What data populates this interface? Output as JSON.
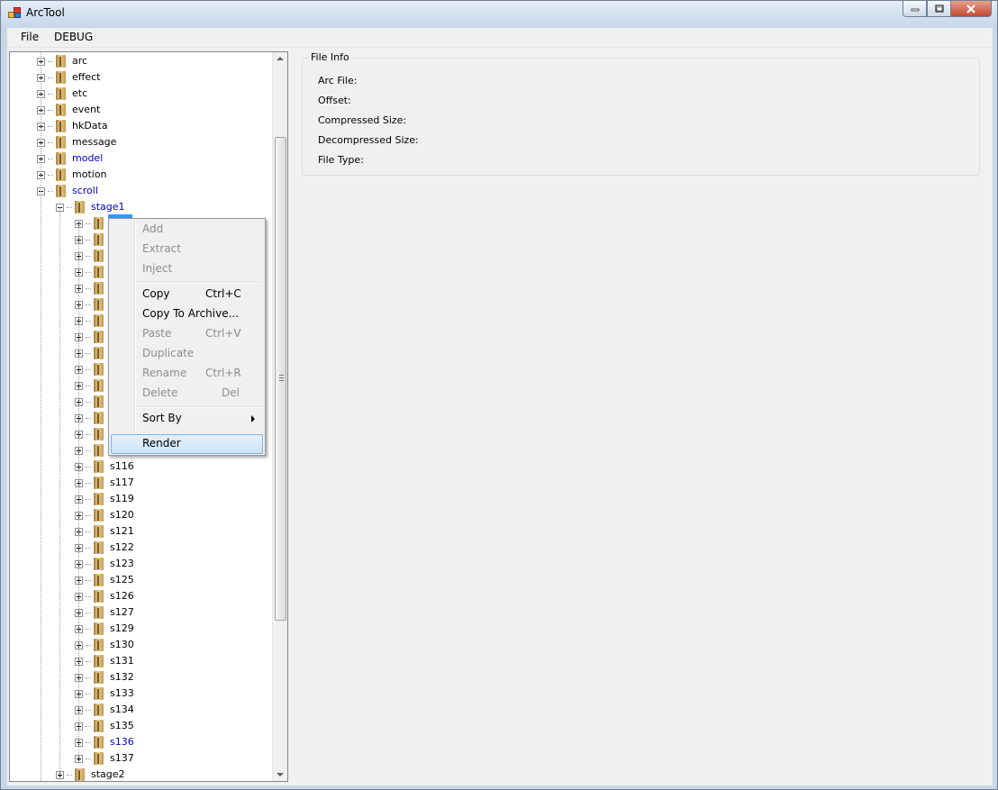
{
  "window": {
    "title": "ArcTool"
  },
  "menubar": {
    "items": [
      "File",
      "DEBUG"
    ]
  },
  "tree": {
    "top": [
      {
        "label": "arc",
        "blue": false
      },
      {
        "label": "effect",
        "blue": false
      },
      {
        "label": "etc",
        "blue": false
      },
      {
        "label": "event",
        "blue": false
      },
      {
        "label": "hkData",
        "blue": false
      },
      {
        "label": "message",
        "blue": false
      },
      {
        "label": "model",
        "blue": true
      },
      {
        "label": "motion",
        "blue": false
      },
      {
        "label": "scroll",
        "blue": true
      }
    ],
    "stage1": "stage1",
    "hidden_children_count": 15,
    "children": [
      {
        "label": "s116",
        "blue": false
      },
      {
        "label": "s117",
        "blue": false
      },
      {
        "label": "s119",
        "blue": false
      },
      {
        "label": "s120",
        "blue": false
      },
      {
        "label": "s121",
        "blue": false
      },
      {
        "label": "s122",
        "blue": false
      },
      {
        "label": "s123",
        "blue": false
      },
      {
        "label": "s125",
        "blue": false
      },
      {
        "label": "s126",
        "blue": false
      },
      {
        "label": "s127",
        "blue": false
      },
      {
        "label": "s129",
        "blue": false
      },
      {
        "label": "s130",
        "blue": false
      },
      {
        "label": "s131",
        "blue": false
      },
      {
        "label": "s132",
        "blue": false
      },
      {
        "label": "s133",
        "blue": false
      },
      {
        "label": "s134",
        "blue": false
      },
      {
        "label": "s135",
        "blue": false
      },
      {
        "label": "s136",
        "blue": true
      },
      {
        "label": "s137",
        "blue": false
      }
    ],
    "stage2": "stage2"
  },
  "file_info": {
    "title": "File Info",
    "arc_file": "Arc File:",
    "offset": "Offset:",
    "compressed": "Compressed Size:",
    "decompressed": "Decompressed Size:",
    "file_type": "File Type:"
  },
  "context_menu": {
    "add": "Add",
    "extract": "Extract",
    "inject": "Inject",
    "copy": "Copy",
    "copy_key": "Ctrl+C",
    "copy_to_archive": "Copy To Archive...",
    "paste": "Paste",
    "paste_key": "Ctrl+V",
    "duplicate": "Duplicate",
    "rename": "Rename",
    "rename_key": "Ctrl+R",
    "delete": "Delete",
    "delete_key": "Del",
    "sort_by": "Sort By",
    "render": "Render"
  },
  "colors": {
    "link_blue": "#0000c8",
    "highlight": "#3399ff"
  }
}
